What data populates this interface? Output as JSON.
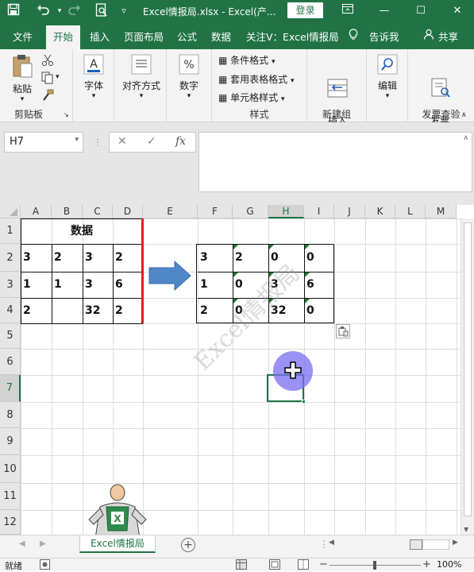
{
  "titlebar": {
    "doc_title": "Excel情报局.xlsx  -  Excel(产...",
    "login": "登录",
    "save_icon": "save-icon",
    "undo_icon": "undo-icon",
    "redo_icon": "redo-icon",
    "preview_icon": "print-preview-icon",
    "customize_icon": "customize-qat-icon"
  },
  "tabs": [
    "文件",
    "开始",
    "插入",
    "页面布局",
    "公式",
    "数据",
    "关注V：Excel情报局",
    "告诉我",
    "共享"
  ],
  "ribbon": {
    "paste": "粘贴",
    "clipboard": "剪贴板",
    "font": "字体",
    "alignment": "对齐方式",
    "number": "数字",
    "conditional": "条件格式",
    "table_format": "套用表格格式",
    "cell_style": "单元格样式",
    "styles": "样式",
    "insert_row": "插入\n工作表行",
    "new_group": "新建组",
    "edit": "编辑",
    "invoice_check": "发票\n查验",
    "invoice_group": "发票查验"
  },
  "formula_bar": {
    "namebox": "H7",
    "fx": "fx",
    "cancel": "✕",
    "confirm": "✓",
    "value": ""
  },
  "columns": [
    "A",
    "B",
    "C",
    "D",
    "E",
    "F",
    "G",
    "H",
    "I",
    "J",
    "K",
    "L",
    "M"
  ],
  "rows": [
    "1",
    "2",
    "3",
    "4",
    "5",
    "6",
    "7",
    "8",
    "9",
    "10",
    "11",
    "12"
  ],
  "selected_col": "H",
  "selected_row": "7",
  "left_table": {
    "header": "数据",
    "rows": [
      [
        "3",
        "2",
        "3",
        "2"
      ],
      [
        "1",
        "1",
        "3",
        "6"
      ],
      [
        "2",
        "",
        "32",
        "2"
      ]
    ]
  },
  "right_table": {
    "rows": [
      [
        "3",
        "2",
        "0",
        "0"
      ],
      [
        "1",
        "0",
        "3",
        "6"
      ],
      [
        "2",
        "0",
        "32",
        "0"
      ]
    ]
  },
  "watermark": "Excel情报局",
  "sheet_tab": "Excel情报局",
  "status": {
    "ready": "就绪",
    "zoom": "100%"
  }
}
